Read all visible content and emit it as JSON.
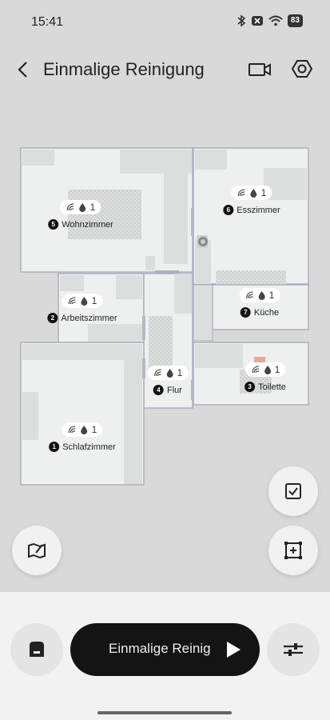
{
  "status": {
    "time": "15:41",
    "battery": "83"
  },
  "header": {
    "title": "Einmalige Reinigung"
  },
  "rooms": [
    {
      "number": "5",
      "name": "Wohnzimmer",
      "count": "1"
    },
    {
      "number": "6",
      "name": "Esszimmer",
      "count": "1"
    },
    {
      "number": "2",
      "name": "Arbeitszimmer",
      "count": "1"
    },
    {
      "number": "7",
      "name": "Küche",
      "count": "1"
    },
    {
      "number": "4",
      "name": "Flur",
      "count": "1"
    },
    {
      "number": "3",
      "name": "Toilette",
      "count": "1"
    },
    {
      "number": "1",
      "name": "Schlafzimmer",
      "count": "1"
    }
  ],
  "bottom": {
    "start_label": "Einmalige Reinig"
  },
  "colors": {
    "background": "#d9d9d9",
    "room_fill": "#eef0f0",
    "room_border": "#a9afbd",
    "start_button": "#141414"
  }
}
